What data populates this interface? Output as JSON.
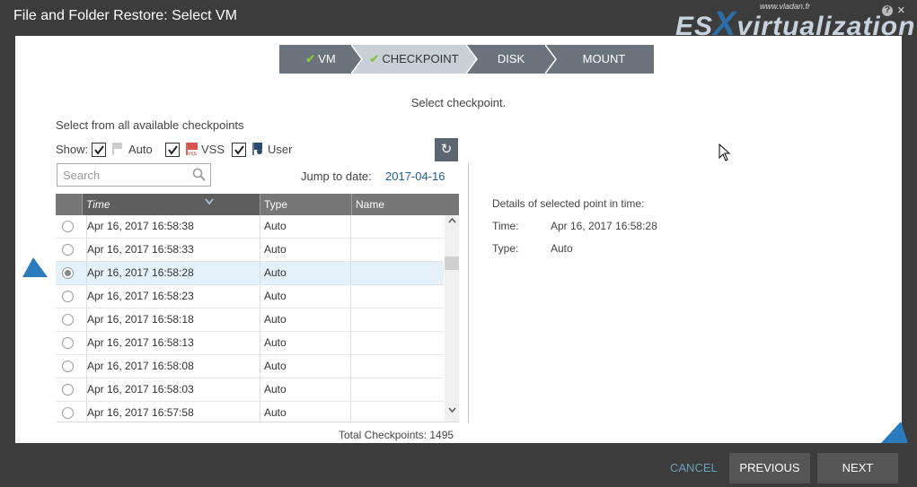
{
  "window": {
    "title": "File and Folder Restore: Select VM"
  },
  "logo": {
    "prefix": "ES",
    "x": "X",
    "rest": "virtualization",
    "url": "www.vladan.fr"
  },
  "wizard": {
    "steps": [
      {
        "label": "VM",
        "done": true
      },
      {
        "label": "CHECKPOINT",
        "done": true
      },
      {
        "label": "DISK",
        "done": false
      },
      {
        "label": "MOUNT",
        "done": false
      }
    ]
  },
  "subtitle": "Select checkpoint.",
  "select_label": "Select from all available checkpoints",
  "filters": {
    "show_label": "Show:",
    "auto_label": "Auto",
    "vss_label": "VSS",
    "user_label": "User"
  },
  "search": {
    "placeholder": "Search"
  },
  "jump": {
    "label": "Jump to date:",
    "date": "2017-04-16"
  },
  "table": {
    "columns": [
      "Time",
      "Type",
      "Name"
    ],
    "rows": [
      {
        "time": "Apr 16, 2017 16:58:38",
        "type": "Auto",
        "name": ""
      },
      {
        "time": "Apr 16, 2017 16:58:33",
        "type": "Auto",
        "name": ""
      },
      {
        "time": "Apr 16, 2017 16:58:28",
        "type": "Auto",
        "name": ""
      },
      {
        "time": "Apr 16, 2017 16:58:23",
        "type": "Auto",
        "name": ""
      },
      {
        "time": "Apr 16, 2017 16:58:18",
        "type": "Auto",
        "name": ""
      },
      {
        "time": "Apr 16, 2017 16:58:13",
        "type": "Auto",
        "name": ""
      },
      {
        "time": "Apr 16, 2017 16:58:08",
        "type": "Auto",
        "name": ""
      },
      {
        "time": "Apr 16, 2017 16:58:03",
        "type": "Auto",
        "name": ""
      },
      {
        "time": "Apr 16, 2017 16:57:58",
        "type": "Auto",
        "name": ""
      }
    ],
    "selected_index": 2
  },
  "details": {
    "label": "Details of selected point in time:",
    "time_key": "Time:",
    "time_value": "Apr 16, 2017 16:58:28",
    "type_key": "Type:",
    "type_value": "Auto"
  },
  "total": "Total Checkpoints: 1495",
  "footer": {
    "cancel": "CANCEL",
    "previous": "PREVIOUS",
    "next": "NEXT"
  },
  "colors": {
    "accent": "#2b7bbf",
    "check": "#8bc34a",
    "step_active": "#c8d0d6",
    "step_inactive": "#6b747c"
  }
}
